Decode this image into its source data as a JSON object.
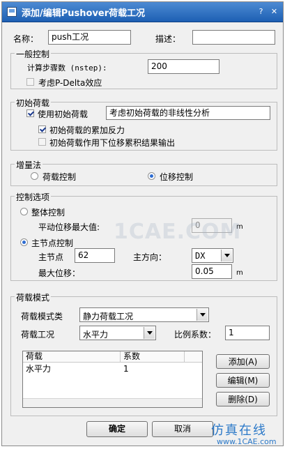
{
  "window": {
    "title": "添加/编辑Pushover荷载工况",
    "help_label": "?",
    "close_label": "✕"
  },
  "name": {
    "label": "名称：",
    "value": "push工况"
  },
  "desc": {
    "label": "描述：",
    "value": ""
  },
  "general": {
    "legend": "一般控制",
    "steps_label": "计算步骤数 (nstep):",
    "steps_value": "200",
    "pdelta_label": "考虑P-Delta效应",
    "pdelta_checked": false
  },
  "initial": {
    "legend": "初始荷载",
    "use_label": "使用初始荷载",
    "use_checked": true,
    "nonlinear_label": "考虑初始荷载的非线性分析",
    "accum_label": "初始荷载的累加反力",
    "accum_checked": true,
    "output_label": "初始荷载作用下位移累积结果输出",
    "output_checked": false
  },
  "increment": {
    "legend": "增量法",
    "load_control": "荷载控制",
    "disp_control": "位移控制",
    "selected": "disp_control"
  },
  "control": {
    "legend": "控制选项",
    "overall_label": "整体控制",
    "avg_disp_label": "平动位移最大值:",
    "avg_disp_value": "0",
    "avg_unit": "m",
    "master_label": "主节点控制",
    "master_node_label": "主节点",
    "master_node_value": "62",
    "direction_label": "主方向：",
    "direction_value": "DX",
    "max_disp_label": "最大位移：",
    "max_disp_value": "0.05",
    "max_unit": "m",
    "selected": "master"
  },
  "load_pattern": {
    "legend": "荷载模式",
    "type_label": "荷载模式类",
    "type_value": "静力荷载工况",
    "case_label": "荷载工况",
    "case_value": "水平力",
    "scale_label": "比例系数：",
    "scale_value": "1",
    "columns": [
      "荷载",
      "系数"
    ],
    "rows": [
      [
        "水平力",
        "1"
      ]
    ],
    "add_label": "添加(A)",
    "edit_label": "编辑(M)",
    "delete_label": "删除(D)"
  },
  "footer": {
    "ok_label": "确定",
    "cancel_label": "取消"
  },
  "watermark": {
    "main": "1CAE.COM",
    "brand": "仿真在线",
    "url": "www.1CAE.com"
  }
}
